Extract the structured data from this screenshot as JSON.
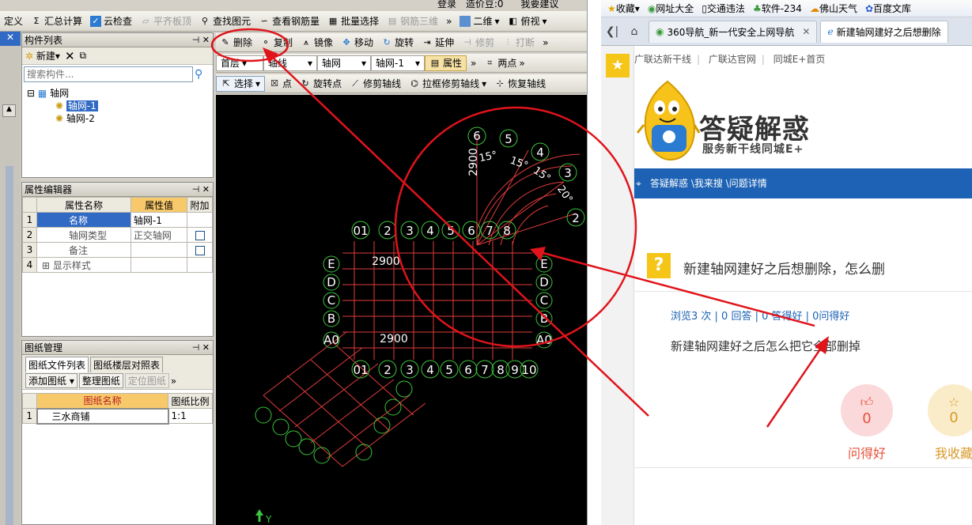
{
  "cad": {
    "menubar": {
      "items": [
        "定义",
        "汇总计算",
        "云检查",
        "平齐板顶",
        "查找图元",
        "查看钢筋量",
        "批量选择",
        "钢筋三维",
        "二维",
        "俯视"
      ],
      "top_right": [
        "登录",
        "造价豆:0",
        "我要建议"
      ]
    },
    "edit_toolbar": [
      "删除",
      "复制",
      "镜像",
      "移动",
      "旋转",
      "延伸",
      "修剪",
      "打断"
    ],
    "layer_bar": {
      "floor": "首层",
      "category": "轴线",
      "type": "轴网",
      "instance": "轴网-1",
      "properties": "属性",
      "two_point": "两点"
    },
    "select_bar": [
      "选择",
      "点",
      "旋转点",
      "修剪轴线",
      "拉框修剪轴线",
      "恢复轴线"
    ],
    "component_list": {
      "title": "构件列表",
      "new_label": "新建",
      "search_placeholder": "搜索构件...",
      "tree_root": "轴网",
      "tree_items": [
        "轴网-1",
        "轴网-2"
      ]
    },
    "property_editor": {
      "title": "属性编辑器",
      "headers": [
        "属性名称",
        "属性值",
        "附加"
      ],
      "rows": [
        {
          "no": "1",
          "name": "名称",
          "value": "轴网-1"
        },
        {
          "no": "2",
          "name": "轴网类型",
          "value": "正交轴网"
        },
        {
          "no": "3",
          "name": "备注",
          "value": ""
        },
        {
          "no": "4",
          "name": "显示样式",
          "value": ""
        }
      ]
    },
    "drawing_mgmt": {
      "title": "图纸管理",
      "tabs": [
        "图纸文件列表",
        "图纸楼层对照表"
      ],
      "buttons": [
        "添加图纸",
        "整理图纸",
        "定位图纸"
      ],
      "headers": [
        "图纸名称",
        "图纸比例"
      ],
      "rows": [
        {
          "no": "1",
          "name": "三水商铺",
          "scale": "1:1"
        }
      ]
    },
    "canvas": {
      "dims": [
        "2900",
        "2900",
        "2900"
      ],
      "axis_nums_top": [
        "01",
        "2",
        "3",
        "4",
        "5",
        "6",
        "7",
        "8"
      ],
      "axis_nums_bottom": [
        "01",
        "2",
        "3",
        "4",
        "5",
        "6",
        "7",
        "8",
        "9",
        "10"
      ],
      "arc_nums": [
        "6",
        "5",
        "4",
        "3",
        "2"
      ],
      "arc_angles": [
        "15°",
        "15°",
        "15°",
        "20°"
      ],
      "left_letters": [
        "E",
        "D",
        "C",
        "B",
        "A0"
      ],
      "right_letters": [
        "E",
        "D",
        "C",
        "B",
        "A0"
      ],
      "y_axis": "Y"
    }
  },
  "browser": {
    "bookmarks": [
      "收藏",
      "网址大全",
      "交通违法",
      "软件-234",
      "佛山天气",
      "百度文库"
    ],
    "tabs": [
      {
        "label": "360导航_新一代安全上网导航"
      },
      {
        "label": "新建轴网建好之后想删除"
      }
    ],
    "site_links": [
      "广联达新干线",
      "广联达官网",
      "同城E+首页"
    ],
    "logo_title": "答疑解惑",
    "logo_sub": "服务新干线同城E+",
    "breadcrumb": "答疑解惑 \\我来搜 \\问题详情",
    "question_title": "新建轴网建好之后想删除，怎么删",
    "stats": "浏览3 次 | 0 回答 | 0 答得好 | 0问得好",
    "body": "新建轴网建好之后怎么把它全部删掉",
    "actions": [
      {
        "count": "0",
        "label": "问得好",
        "color": "#e8503a"
      },
      {
        "count": "0",
        "label": "我收藏",
        "color": "#d89a2a"
      }
    ]
  }
}
